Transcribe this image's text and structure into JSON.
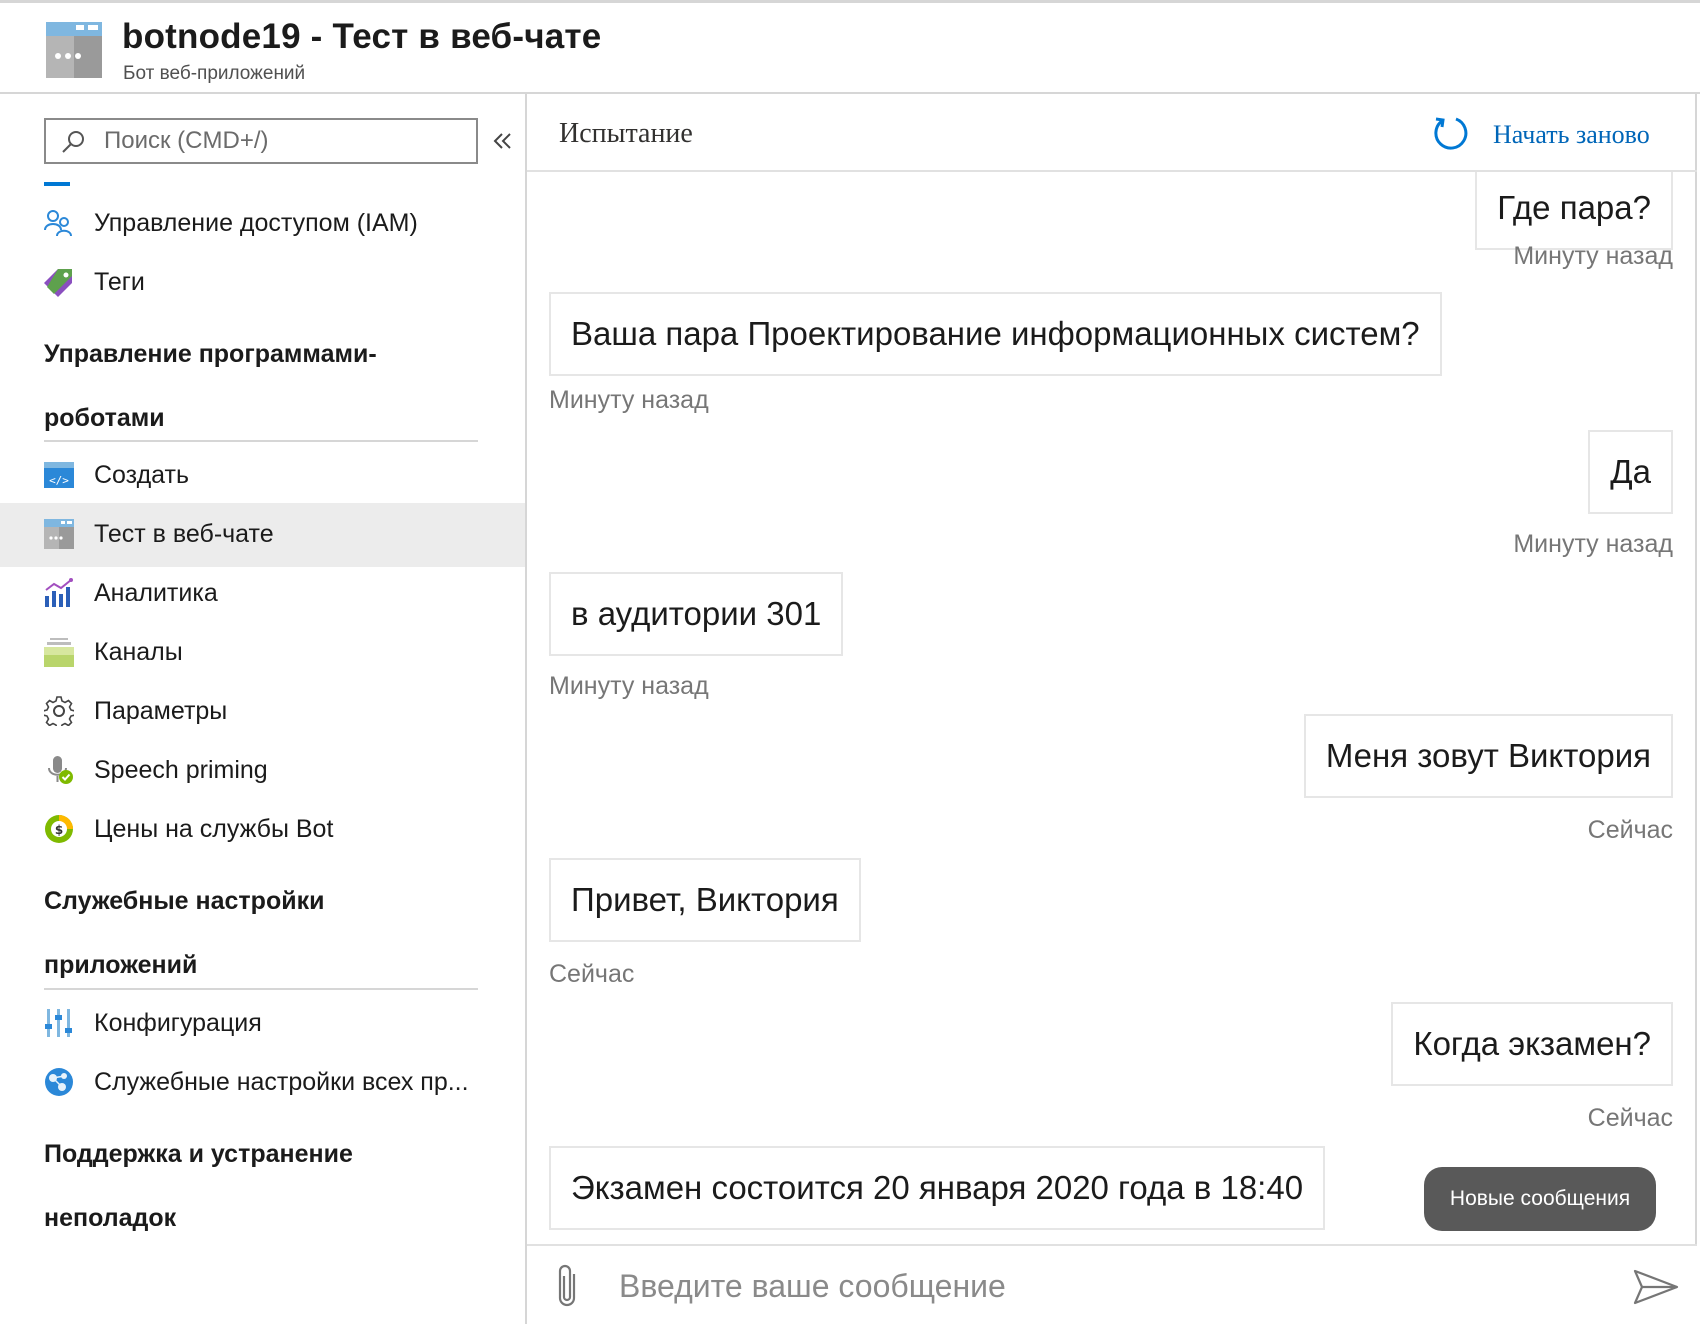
{
  "header": {
    "title": "botnode19 - Тест в веб-чате",
    "subtitle": "Бот веб-приложений"
  },
  "sidebar": {
    "search_placeholder": "Поиск (CMD+/)",
    "items_top": [
      {
        "label": "Управление доступом (IAM)",
        "icon": "people-icon"
      },
      {
        "label": "Теги",
        "icon": "tag-icon"
      }
    ],
    "section_bot_management": "Управление программами-роботами",
    "items_bot": [
      {
        "label": "Создать",
        "icon": "code-icon"
      },
      {
        "label": "Тест в веб-чате",
        "icon": "webchat-icon",
        "active": true
      },
      {
        "label": "Аналитика",
        "icon": "analytics-icon"
      },
      {
        "label": "Каналы",
        "icon": "channels-icon"
      },
      {
        "label": "Параметры",
        "icon": "gear-icon"
      },
      {
        "label": "Speech priming",
        "icon": "microphone-icon"
      },
      {
        "label": "Цены на службы Bot",
        "icon": "pricing-icon"
      }
    ],
    "section_app_service": "Служебные настройки приложений",
    "items_app": [
      {
        "label": "Конфигурация",
        "icon": "sliders-icon"
      },
      {
        "label": "Служебные настройки всех пр...",
        "icon": "globe-icon"
      }
    ],
    "section_support": "Поддержка и устранение неполадок"
  },
  "chat": {
    "title": "Испытание",
    "restart_label": "Начать заново",
    "messages": [
      {
        "from": "user",
        "text": "Где пара?",
        "time": "Минуту назад"
      },
      {
        "from": "bot",
        "text": "Ваша пара Проектирование информационных систем?",
        "time": "Минуту назад"
      },
      {
        "from": "user",
        "text": "Да",
        "time": "Минуту назад"
      },
      {
        "from": "bot",
        "text": "в аудитории 301",
        "time": "Минуту назад"
      },
      {
        "from": "user",
        "text": "Меня зовут Виктория",
        "time": "Сейчас"
      },
      {
        "from": "bot",
        "text": "Привет, Виктория",
        "time": "Сейчас"
      },
      {
        "from": "user",
        "text": "Когда экзамен?",
        "time": "Сейчас"
      },
      {
        "from": "bot",
        "text": "Экзамен состоится 20 января 2020 года в 18:40",
        "time": ""
      }
    ],
    "new_messages_label": "Новые сообщения",
    "input_placeholder": "Введите ваше сообщение"
  },
  "colors": {
    "accent": "#0078d4",
    "link": "#0066b8",
    "active_item_bg": "#ececec",
    "pill_bg": "#595959"
  }
}
